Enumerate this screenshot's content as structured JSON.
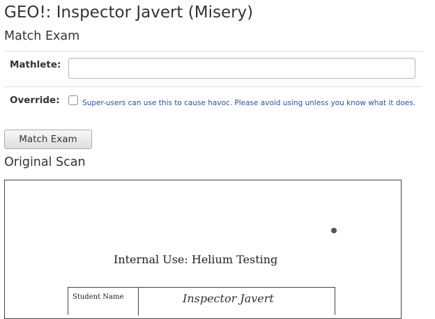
{
  "page": {
    "title": "GEO!: Inspector Javert (Misery)"
  },
  "match_section": {
    "heading": "Match Exam",
    "mathlete_label": "Mathlete:",
    "mathlete_value": "",
    "override_label": "Override:",
    "override_checked": false,
    "override_help": "Super-users can use this to cause havoc. Please avoid using unless you know what it does.",
    "submit_label": "Match Exam"
  },
  "scan_section": {
    "heading": "Original Scan",
    "scan_heading": "Internal Use: Helium Testing",
    "student_name_label": "Student Name",
    "student_name_value": "Inspector Javert"
  },
  "colors": {
    "help_text": "#2a4fa8",
    "divider": "#dddddd"
  }
}
